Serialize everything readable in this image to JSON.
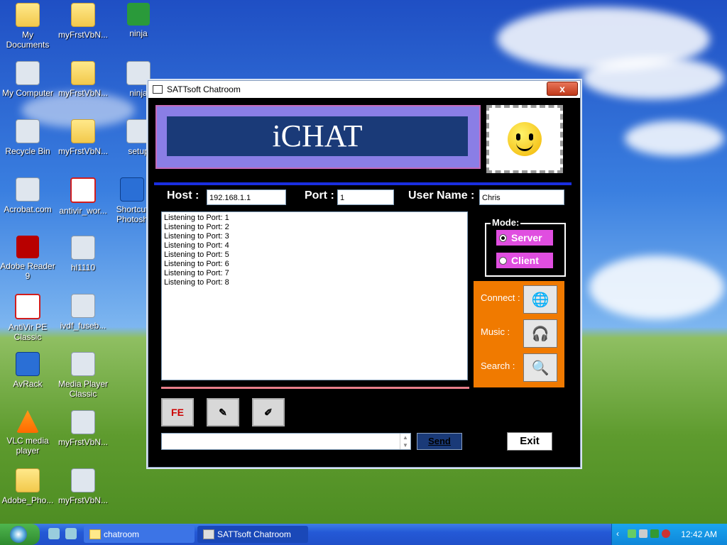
{
  "desktop": {
    "icons": [
      {
        "label": "My Documents"
      },
      {
        "label": "myFrstVbN..."
      },
      {
        "label": "ninja"
      },
      {
        "label": "My Computer"
      },
      {
        "label": "myFrstVbN..."
      },
      {
        "label": "ninja"
      },
      {
        "label": "Recycle Bin"
      },
      {
        "label": "myFrstVbN..."
      },
      {
        "label": "setup"
      },
      {
        "label": "Acrobat.com"
      },
      {
        "label": "antivir_wor..."
      },
      {
        "label": "Shortcut Photosh"
      },
      {
        "label": "Adobe Reader 9"
      },
      {
        "label": "hl1110"
      },
      {
        "label": "AntiVir PE Classic"
      },
      {
        "label": "ivdf_fuseb..."
      },
      {
        "label": "AvRack"
      },
      {
        "label": "Media Player Classic"
      },
      {
        "label": "VLC media player"
      },
      {
        "label": "myFrstVbN..."
      },
      {
        "label": "Adobe_Pho..."
      },
      {
        "label": "myFrstVbN..."
      }
    ]
  },
  "window": {
    "title": "SATTsoft Chatroom",
    "close": "x",
    "banner": "iCHAT",
    "host_label": "Host :",
    "host_value": "192.168.1.1",
    "port_label": "Port :",
    "port_value": "1",
    "user_label": "User Name :",
    "user_value": "Chris",
    "log": [
      "Listening to Port: 1",
      "Listening to Port: 2",
      "Listening to Port: 3",
      "Listening to Port: 4",
      "Listening to Port: 5",
      "Listening to Port: 6",
      "Listening to Port: 7",
      "Listening to Port: 8"
    ],
    "mode_title": "Mode:",
    "mode_server": "Server",
    "mode_client": "Client",
    "connect_label": "Connect :",
    "music_label": "Music :",
    "search_label": "Search :",
    "tool_fe": "FE",
    "send": "Send",
    "exit": "Exit"
  },
  "taskbar": {
    "tasks": [
      {
        "label": "chatroom"
      },
      {
        "label": "SATTsoft Chatroom"
      }
    ],
    "clock": "12:42 AM"
  }
}
